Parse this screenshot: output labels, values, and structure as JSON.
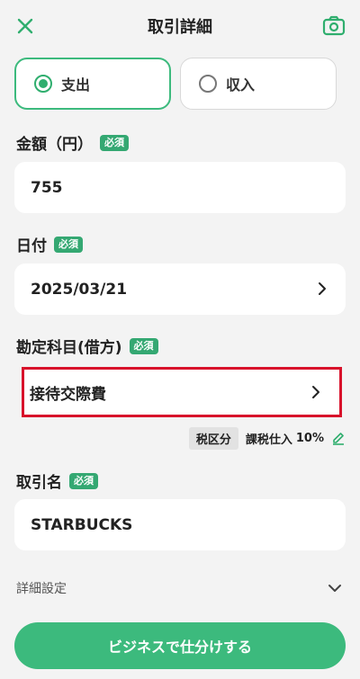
{
  "header": {
    "title": "取引詳細",
    "close_icon": "close-icon",
    "camera_icon": "camera-icon"
  },
  "type_toggle": {
    "expense_label": "支出",
    "income_label": "収入",
    "selected": "支出"
  },
  "required_badge": "必須",
  "amount": {
    "label": "金額（円）",
    "value": "755"
  },
  "date": {
    "label": "日付",
    "value": "2025/03/21"
  },
  "account": {
    "label": "勘定科目(借方)",
    "value": "接待交際費"
  },
  "tax": {
    "tag": "税区分",
    "type": "課税仕入",
    "rate": "10%"
  },
  "transaction_name": {
    "label": "取引名",
    "value": "STARBUCKS"
  },
  "detail_settings": {
    "label": "詳細設定"
  },
  "submit_button": {
    "label": "ビジネスで仕分けする"
  },
  "colors": {
    "accent": "#3cba7d",
    "badge": "#34a872",
    "highlight": "#d8122b"
  }
}
